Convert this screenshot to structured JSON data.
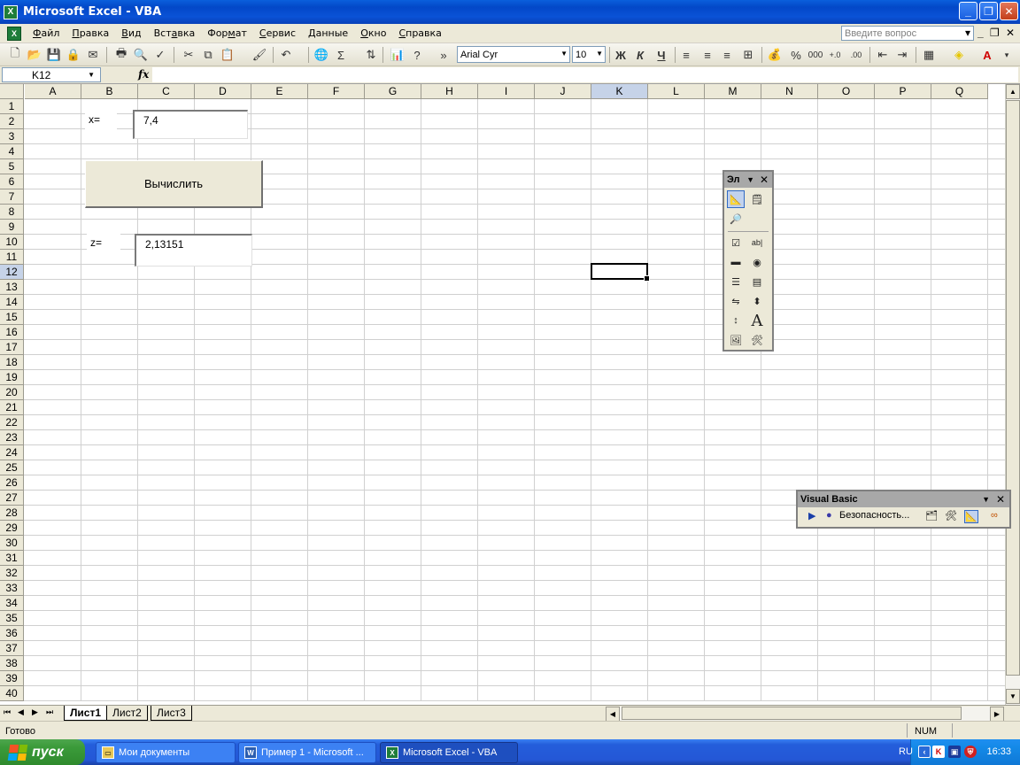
{
  "window": {
    "title": "Microsoft Excel - VBA",
    "app_icon": "X"
  },
  "menu": {
    "items": [
      {
        "pre": "",
        "u": "Ф",
        "post": "айл"
      },
      {
        "pre": "",
        "u": "П",
        "post": "равка"
      },
      {
        "pre": "",
        "u": "В",
        "post": "ид"
      },
      {
        "pre": "Вст",
        "u": "а",
        "post": "вка"
      },
      {
        "pre": "Фор",
        "u": "м",
        "post": "ат"
      },
      {
        "pre": "",
        "u": "С",
        "post": "ервис"
      },
      {
        "pre": "",
        "u": "Д",
        "post": "анные"
      },
      {
        "pre": "",
        "u": "О",
        "post": "кно"
      },
      {
        "pre": "",
        "u": "С",
        "post": "правка"
      }
    ],
    "question_placeholder": "Введите вопрос"
  },
  "toolbar": {
    "font_name": "Arial Cyr",
    "font_size": "10",
    "bold": "Ж",
    "italic": "К",
    "underline": "Ч",
    "percent": "%",
    "thousands": "000"
  },
  "formula_bar": {
    "name_box": "K12",
    "fx": "fx",
    "formula": ""
  },
  "columns": [
    "A",
    "B",
    "C",
    "D",
    "E",
    "F",
    "G",
    "H",
    "I",
    "J",
    "K",
    "L",
    "M",
    "N",
    "O",
    "P",
    "Q"
  ],
  "rows": [
    "1",
    "2",
    "3",
    "4",
    "5",
    "6",
    "7",
    "8",
    "9",
    "10",
    "11",
    "12",
    "13",
    "14",
    "15",
    "16",
    "17",
    "18",
    "19",
    "20",
    "21",
    "22",
    "23",
    "24",
    "25",
    "26",
    "27",
    "28",
    "29",
    "30",
    "31",
    "32",
    "33",
    "34",
    "35",
    "36",
    "37",
    "38",
    "39",
    "40"
  ],
  "selected_cell": {
    "column": "K",
    "row": "12"
  },
  "form": {
    "x_label": "x=",
    "x_value": "7,4",
    "button_label": "Вычислить",
    "z_label": "z=",
    "z_value": "2,13151"
  },
  "controls_toolbar": {
    "caption": "Эл"
  },
  "vb_toolbar": {
    "caption": "Visual Basic",
    "security_label": "Безопасность..."
  },
  "sheets": {
    "tabs": [
      "Лист1",
      "Лист2",
      "Лист3"
    ],
    "active": "Лист1"
  },
  "status": {
    "text": "Готово",
    "num": "NUM"
  },
  "taskbar": {
    "start_label": "пуск",
    "items": [
      "Мои документы",
      "Пример 1 - Microsoft ...",
      "Microsoft Excel - VBA"
    ],
    "active_item": "Microsoft Excel - VBA",
    "lang": "RU",
    "clock": "16:33"
  }
}
